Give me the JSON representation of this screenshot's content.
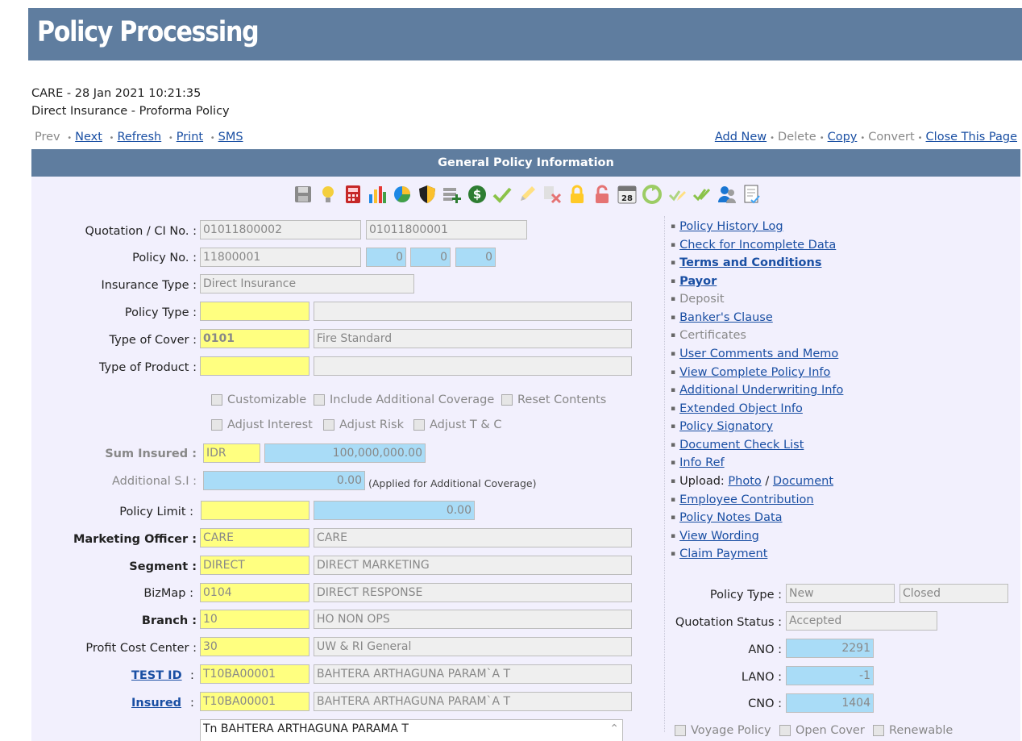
{
  "header": {
    "title": "Policy Processing"
  },
  "info": {
    "line1": "CARE - 28 Jan 2021 10:21:35",
    "line2": "Direct Insurance - Proforma Policy"
  },
  "nav_left": {
    "prev": "Prev",
    "next": "Next",
    "refresh": "Refresh",
    "print": "Print",
    "sms": "SMS"
  },
  "nav_right": {
    "add_new": "Add New",
    "delete": "Delete",
    "copy": "Copy",
    "convert": "Convert",
    "close": "Close This Page"
  },
  "section": {
    "title": "General Policy Information"
  },
  "toolbar_icons": [
    "save-icon",
    "lightbulb-icon",
    "calculator-icon",
    "bar-chart-icon",
    "pie-chart-icon",
    "shield-icon",
    "stack-add-icon",
    "dollar-icon",
    "check-icon",
    "pencil-icon",
    "cancel-icon",
    "lock-icon",
    "unlock-icon",
    "calendar-icon",
    "recycle-icon",
    "approve-edit-icon",
    "double-check-icon",
    "user-group-icon",
    "document-check-icon"
  ],
  "form": {
    "quotation": {
      "label": "Quotation / CI No. :",
      "v1": "01011800002",
      "v2": "01011800001"
    },
    "policy_no": {
      "label": "Policy No. :",
      "v1": "11800001",
      "n1": "0",
      "n2": "0",
      "n3": "0"
    },
    "insurance_type": {
      "label": "Insurance Type :",
      "value": "Direct Insurance"
    },
    "policy_type": {
      "label": "Policy Type :",
      "code": "",
      "desc": ""
    },
    "type_of_cover": {
      "label": "Type of Cover :",
      "code": "0101",
      "desc": "Fire Standard"
    },
    "type_of_product": {
      "label": "Type of Product :",
      "code": "",
      "desc": ""
    },
    "checks_row1": [
      "Customizable",
      "Include Additional Coverage",
      "Reset Contents"
    ],
    "checks_row2": [
      "Adjust Interest",
      "Adjust Risk",
      "Adjust T & C"
    ],
    "sum_insured": {
      "label": "Sum Insured :",
      "currency": "IDR",
      "amount": "100,000,000.00"
    },
    "additional_si": {
      "label": "Additional S.I :",
      "amount": "0.00",
      "note": "(Applied for Additional Coverage)"
    },
    "policy_limit": {
      "label": "Policy Limit :",
      "code": "",
      "amount": "0.00"
    },
    "marketing_officer": {
      "label": "Marketing Officer :",
      "code": "CARE",
      "desc": "CARE"
    },
    "segment": {
      "label": "Segment :",
      "code": "DIRECT",
      "desc": "DIRECT MARKETING"
    },
    "bizmap": {
      "label": "BizMap :",
      "code": "0104",
      "desc": "DIRECT RESPONSE"
    },
    "branch": {
      "label": "Branch :",
      "code": "10",
      "desc": "HO NON OPS"
    },
    "profit_cost_center": {
      "label": "Profit Cost Center :",
      "code": "30",
      "desc": "UW & RI General"
    },
    "test_id": {
      "label": "TEST ID",
      "colon": ":",
      "code": "T10BA00001",
      "desc": "BAHTERA ARTHAGUNA PARAM`A  T"
    },
    "insured": {
      "label": "Insured",
      "colon": ":",
      "code": "T10BA00001",
      "desc": "BAHTERA ARTHAGUNA PARAM`A  T"
    },
    "insured_name": {
      "value": "Tn BAHTERA ARTHAGUNA PARAMA T"
    }
  },
  "right_links": {
    "policy_history": "Policy History Log",
    "check_incomplete": "Check for Incomplete Data",
    "terms": "Terms and Conditions",
    "payor": "Payor",
    "deposit": "Deposit",
    "bankers_clause": "Banker's Clause",
    "certificates": "Certificates",
    "user_comments": "User Comments and Memo",
    "view_complete": "View Complete Policy Info",
    "additional_uw": "Additional Underwriting Info",
    "extended_object": "Extended Object Info",
    "policy_signatory": "Policy Signatory",
    "doc_checklist": "Document Check List",
    "info_ref": "Info Ref",
    "upload_label": "Upload:",
    "upload_photo": "Photo",
    "upload_slash": "/",
    "upload_document": "Document",
    "employee_contribution": "Employee Contribution",
    "policy_notes": "Policy Notes Data",
    "view_wording": "View Wording",
    "claim_payment": "Claim Payment"
  },
  "status": {
    "policy_type": {
      "label": "Policy Type :",
      "v1": "New",
      "v2": "Closed"
    },
    "quotation_status": {
      "label": "Quotation Status :",
      "value": "Accepted"
    },
    "ano": {
      "label": "ANO :",
      "value": "2291"
    },
    "lano": {
      "label": "LANO :",
      "value": "-1"
    },
    "cno": {
      "label": "CNO :",
      "value": "1404"
    },
    "checks": [
      "Voyage Policy",
      "Open Cover",
      "Renewable"
    ]
  }
}
